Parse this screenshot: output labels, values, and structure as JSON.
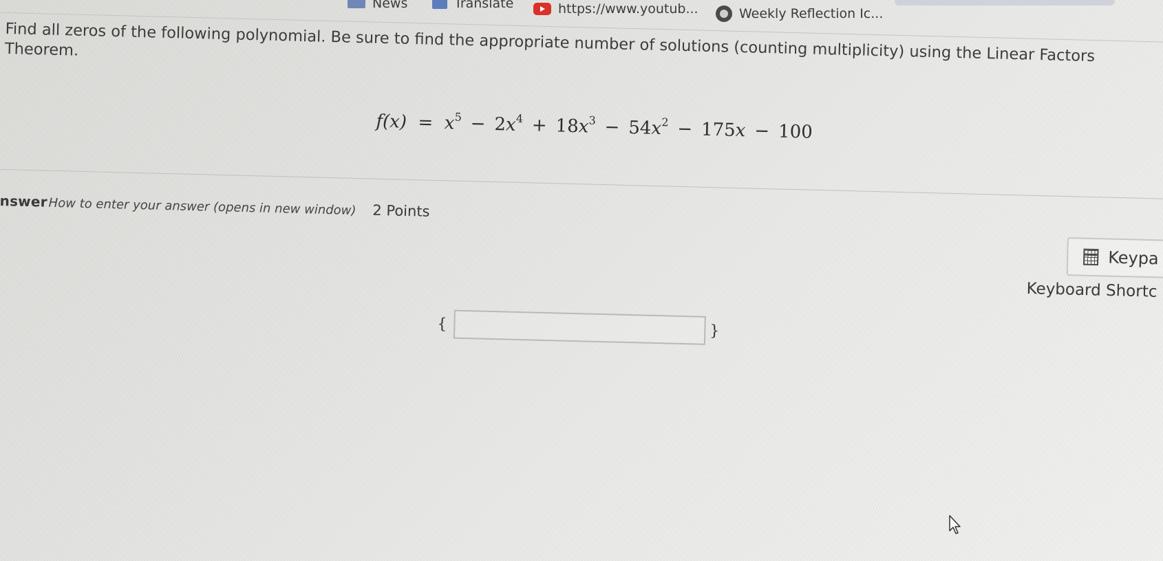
{
  "bookmarks": {
    "news_label": "News",
    "translate_label": "Translate",
    "youtube_label": "https://www.youtub...",
    "weekly_label": "Weekly Reflection Ic..."
  },
  "question": {
    "text": "Find all zeros of the following polynomial. Be sure to find the appropriate number of solutions (counting multiplicity) using the Linear Factors Theorem.",
    "formula": {
      "lhs": "f(x)",
      "equals": "=",
      "terms": [
        {
          "coef": "",
          "var": "x",
          "exp": "5",
          "sign": ""
        },
        {
          "coef": "2",
          "var": "x",
          "exp": "4",
          "sign": "−"
        },
        {
          "coef": "18",
          "var": "x",
          "exp": "3",
          "sign": "+"
        },
        {
          "coef": "54",
          "var": "x",
          "exp": "2",
          "sign": "−"
        },
        {
          "coef": "175",
          "var": "x",
          "exp": "",
          "sign": "−"
        },
        {
          "coef": "100",
          "var": "",
          "exp": "",
          "sign": "−"
        }
      ]
    }
  },
  "answer": {
    "label": "nswer",
    "howto_link": "How to enter your answer (opens in new window)",
    "points": "2 Points",
    "open_brace": "{",
    "close_brace": "}",
    "input_value": ""
  },
  "tools": {
    "keypad_label": "Keypa",
    "keyboard_shortcuts_label": "Keyboard Shortc"
  },
  "icons": [
    "news-icon",
    "translate-icon",
    "youtube-icon",
    "globe-icon",
    "calculator-icon",
    "mouse-pointer-icon"
  ]
}
